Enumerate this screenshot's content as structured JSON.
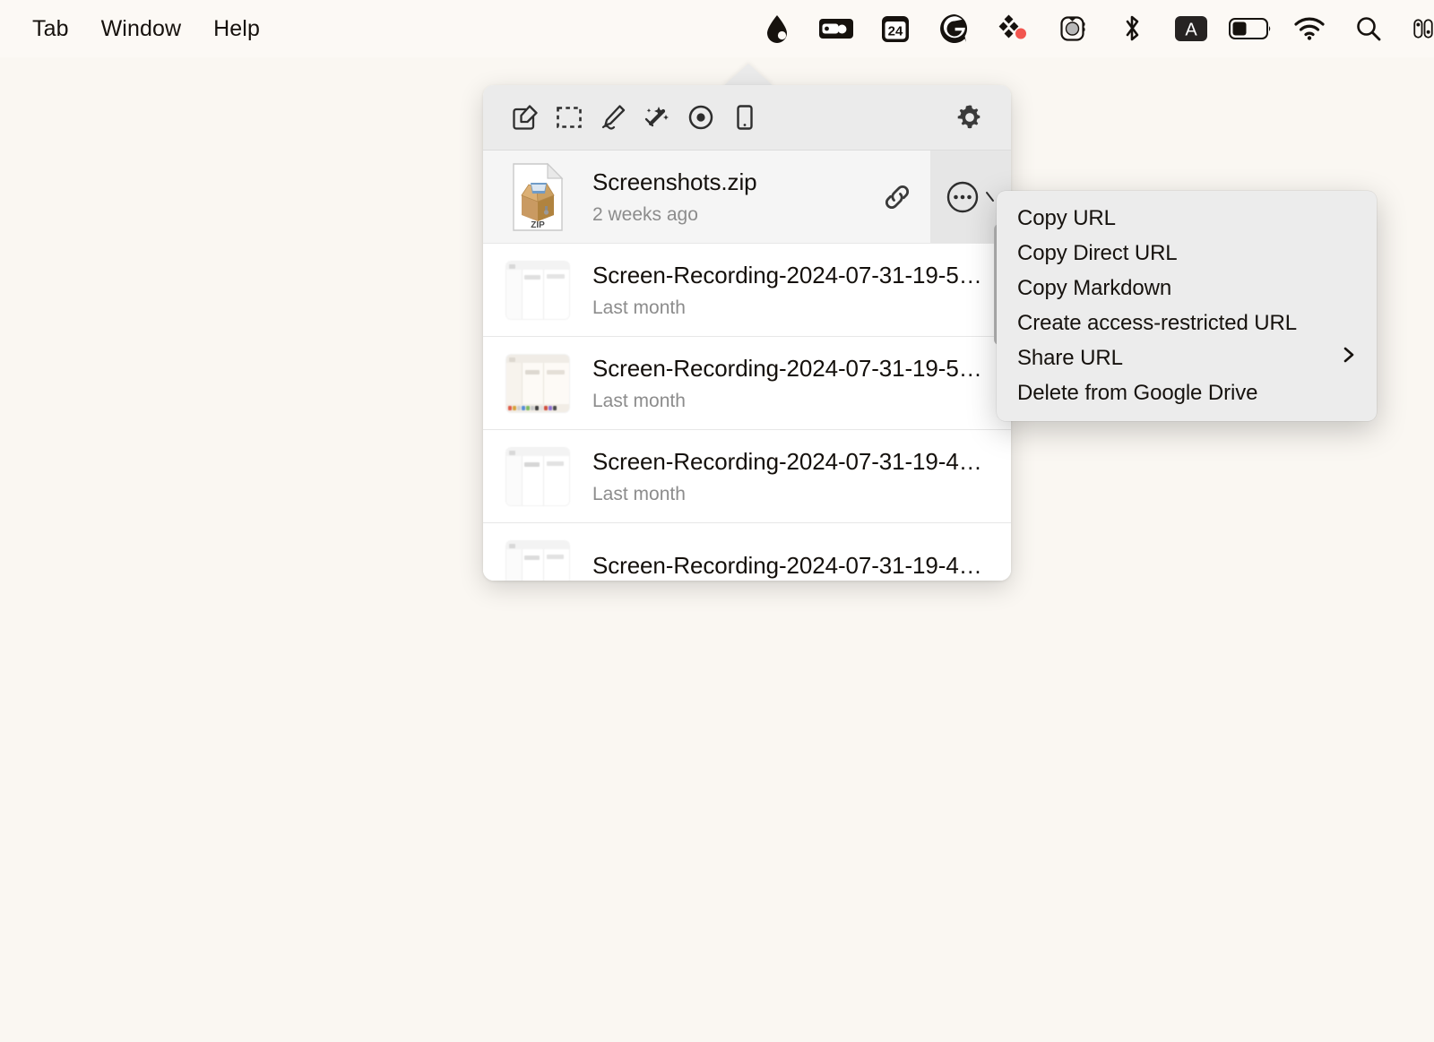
{
  "menubar": {
    "items": [
      {
        "label": "Tab"
      },
      {
        "label": "Window"
      },
      {
        "label": "Help"
      }
    ],
    "status_icons": [
      {
        "name": "droplet-icon",
        "glyph": "droplet"
      },
      {
        "name": "wallet-icon",
        "glyph": "wallet"
      },
      {
        "name": "calendar-24-icon",
        "glyph": "24"
      },
      {
        "name": "grammarly-icon",
        "glyph": "G"
      },
      {
        "name": "dropbox-dots-icon",
        "glyph": "dots"
      },
      {
        "name": "airpods-case-icon",
        "glyph": "case"
      },
      {
        "name": "bluetooth-icon",
        "glyph": "bluetooth"
      },
      {
        "name": "keyboard-input-A-icon",
        "glyph": "A"
      },
      {
        "name": "battery-icon",
        "glyph": "battery"
      },
      {
        "name": "wifi-icon",
        "glyph": "wifi"
      },
      {
        "name": "spotlight-search-icon",
        "glyph": "search"
      },
      {
        "name": "control-center-icon",
        "glyph": "control"
      }
    ]
  },
  "popover": {
    "toolbar": {
      "buttons": [
        {
          "name": "capture-edit-button",
          "tooltip": "Capture"
        },
        {
          "name": "crop-selection-button",
          "tooltip": "Select area"
        },
        {
          "name": "annotate-pen-button",
          "tooltip": "Annotate"
        },
        {
          "name": "scrubber-wand-button",
          "tooltip": "Scrub"
        },
        {
          "name": "record-button",
          "tooltip": "Record"
        },
        {
          "name": "mobile-device-button",
          "tooltip": "Mobile"
        }
      ],
      "settings": {
        "name": "settings-gear-button",
        "tooltip": "Settings"
      }
    },
    "files": [
      {
        "name": "Screenshots.zip",
        "date": "2 weeks ago",
        "thumb": "zip",
        "selected": true,
        "has_actions": true
      },
      {
        "name": "Screen-Recording-2024-07-31-19-5…",
        "date": "Last month",
        "thumb": "light",
        "selected": false,
        "has_actions": false
      },
      {
        "name": "Screen-Recording-2024-07-31-19-5…",
        "date": "Last month",
        "thumb": "warm",
        "selected": false,
        "has_actions": false
      },
      {
        "name": "Screen-Recording-2024-07-31-19-4…",
        "date": "Last month",
        "thumb": "light",
        "selected": false,
        "has_actions": false
      },
      {
        "name": "Screen-Recording-2024-07-31-19-4…",
        "date": "",
        "thumb": "light",
        "selected": false,
        "has_actions": false
      }
    ]
  },
  "context_menu": {
    "items": [
      {
        "label": "Copy URL",
        "submenu": false
      },
      {
        "label": "Copy Direct URL",
        "submenu": false
      },
      {
        "label": "Copy Markdown",
        "submenu": false
      },
      {
        "label": "Create access-restricted URL",
        "submenu": false
      },
      {
        "label": "Share URL",
        "submenu": true
      },
      {
        "label": "Delete from Google Drive",
        "submenu": false
      }
    ]
  },
  "colors": {
    "desktop_bg": "#faf7f2",
    "menubar_bg": "#fcf9f5",
    "toolbar_bg": "#ebebeb",
    "panel_bg": "#ffffff",
    "row_selected_bg": "#f5f5f5",
    "menu_bg": "#ececec",
    "text_primary": "#16120e",
    "text_secondary": "#8c8c8c",
    "accent_red": "#f2564f"
  }
}
